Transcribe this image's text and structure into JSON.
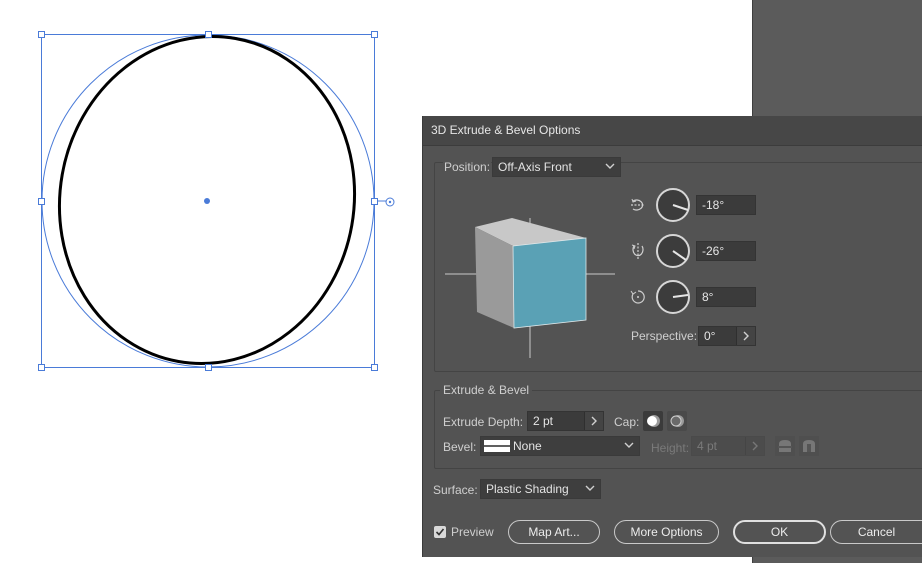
{
  "dialog": {
    "title": "3D Extrude & Bevel Options",
    "position_label": "Position:",
    "position_value": "Off-Axis Front",
    "rotation": {
      "x_value": "-18°",
      "y_value": "-26°",
      "z_value": "8°",
      "x_icon": "rotate-x-axis-icon",
      "y_icon": "rotate-y-axis-icon",
      "z_icon": "rotate-z-axis-icon"
    },
    "perspective_label": "Perspective:",
    "perspective_value": "0°",
    "extrude_section_title": "Extrude & Bevel",
    "extrude_depth_label": "Extrude Depth:",
    "extrude_depth_value": "2 pt",
    "cap_label": "Cap:",
    "bevel_label": "Bevel:",
    "bevel_value": "None",
    "height_label": "Height:",
    "height_value": "4 pt",
    "surface_label": "Surface:",
    "surface_value": "Plastic Shading",
    "preview_label": "Preview",
    "preview_checked": true,
    "buttons": {
      "map_art": "Map Art...",
      "more_options": "More Options",
      "ok": "OK",
      "cancel": "Cancel"
    }
  },
  "colors": {
    "dialog_bg": "#535353",
    "cube_front": "#5aa1b5",
    "cube_top": "#c8c8c8",
    "cube_side": "#9a9a9a",
    "selection": "#4a7bd8"
  }
}
